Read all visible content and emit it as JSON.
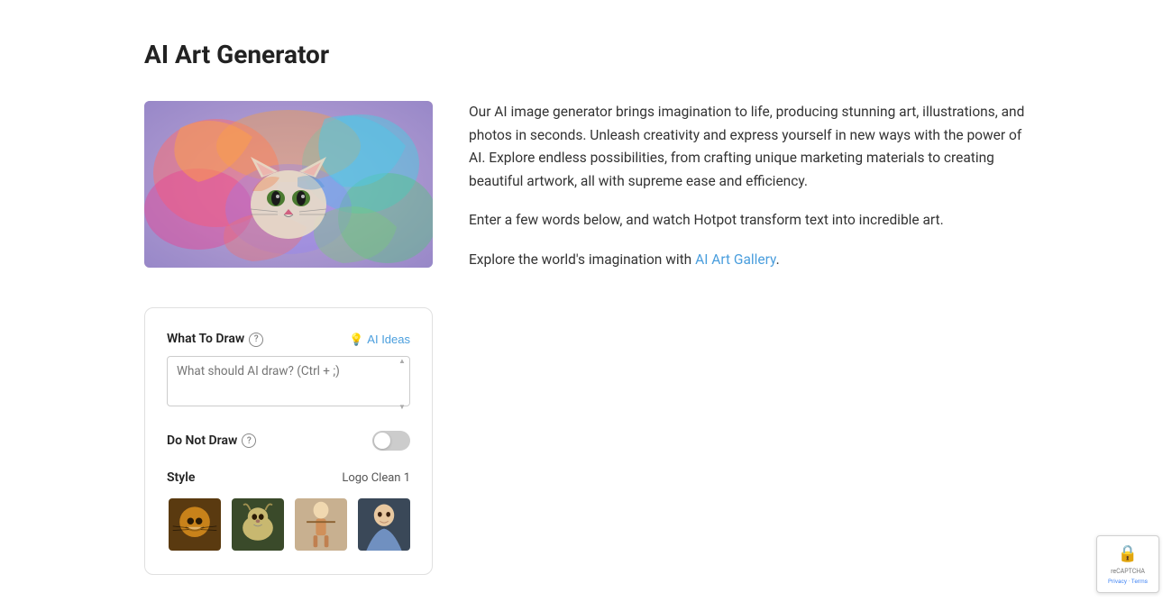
{
  "page": {
    "title": "AI Art Generator"
  },
  "description": {
    "para1": "Our AI image generator brings imagination to life, producing stunning art, illustrations, and photos in seconds. Unleash creativity and express yourself in new ways with the power of AI. Explore endless possibilities, from crafting unique marketing materials to creating beautiful artwork, all with supreme ease and efficiency.",
    "para2": "Enter a few words below, and watch Hotpot transform text into incredible art.",
    "para3_prefix": "Explore the world's imagination with ",
    "gallery_link_text": "AI Art Gallery",
    "gallery_link_url": "#",
    "para3_suffix": "."
  },
  "form": {
    "what_to_draw_label": "What To Draw",
    "what_to_draw_help": "?",
    "ai_ideas_label": "AI Ideas",
    "textarea_placeholder": "What should AI draw? (Ctrl + ;)",
    "do_not_draw_label": "Do Not Draw",
    "do_not_draw_help": "?",
    "style_label": "Style",
    "style_value": "Logo Clean 1"
  },
  "style_thumbnails": [
    {
      "id": "tiger",
      "label": "Tiger style",
      "bg": "#8b6914",
      "accent": "#f0a020"
    },
    {
      "id": "goat",
      "label": "Goat style",
      "bg": "#6b7a4a",
      "accent": "#c8b870"
    },
    {
      "id": "violin",
      "label": "Violin style",
      "bg": "#c8b090",
      "accent": "#e8d0b0"
    },
    {
      "id": "portrait",
      "label": "Portrait style",
      "bg": "#4a5a6a",
      "accent": "#8090a0"
    }
  ],
  "recaptcha": {
    "logo": "🔒",
    "line1": "reCAPTCHA",
    "line2": "Privacy - Terms"
  },
  "icons": {
    "lightbulb": "💡",
    "help": "?"
  }
}
